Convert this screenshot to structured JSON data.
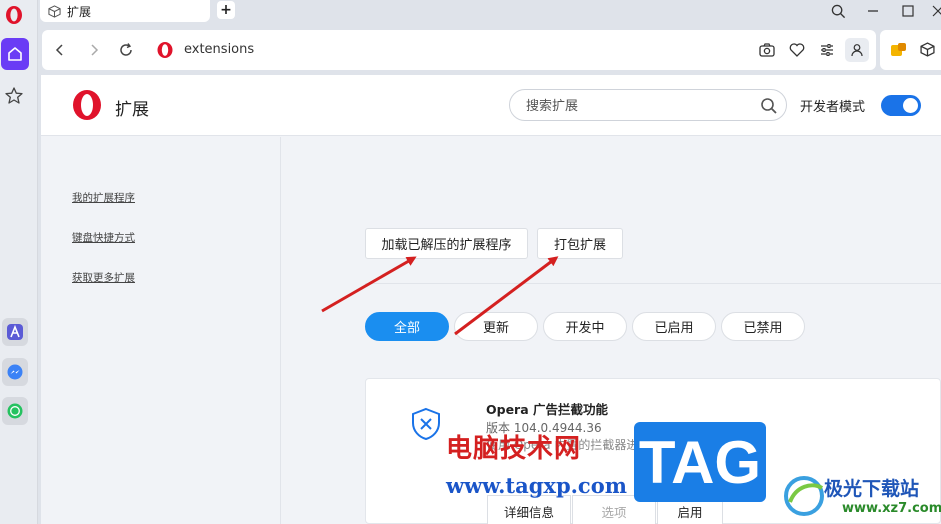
{
  "tab": {
    "title": "扩展"
  },
  "address": {
    "url": "extensions"
  },
  "header": {
    "title": "扩展",
    "search_placeholder": "搜索扩展",
    "dev_mode_label": "开发者模式",
    "dev_mode_on": true
  },
  "sidebar_links": [
    "我的扩展程序",
    "键盘快捷方式",
    "获取更多扩展"
  ],
  "actions": {
    "load_unpacked": "加载已解压的扩展程序",
    "pack": "打包扩展"
  },
  "filters": [
    {
      "label": "全部",
      "active": true
    },
    {
      "label": "更新",
      "active": false
    },
    {
      "label": "开发中",
      "active": false
    },
    {
      "label": "已启用",
      "active": false
    },
    {
      "label": "已禁用",
      "active": false
    }
  ],
  "extension": {
    "name": "Opera 广告拦截功能",
    "version": "版本 104.0.4944.36",
    "description": "使用 Opera 内置的拦截器进行更快速的浏览",
    "buttons": {
      "details": "详细信息",
      "options": "选项",
      "enable": "启用"
    }
  },
  "watermarks": {
    "cn": "电脑技术网",
    "url": "www.tagxp.com",
    "tag": "TAG",
    "site_cn": "极光下载站",
    "site_url": "www.xz7.com"
  },
  "colors": {
    "accent": "#1a73e8",
    "opera_red": "#e0132b",
    "arrow": "#d42020",
    "sidebar_active": "#6a3cf5"
  }
}
